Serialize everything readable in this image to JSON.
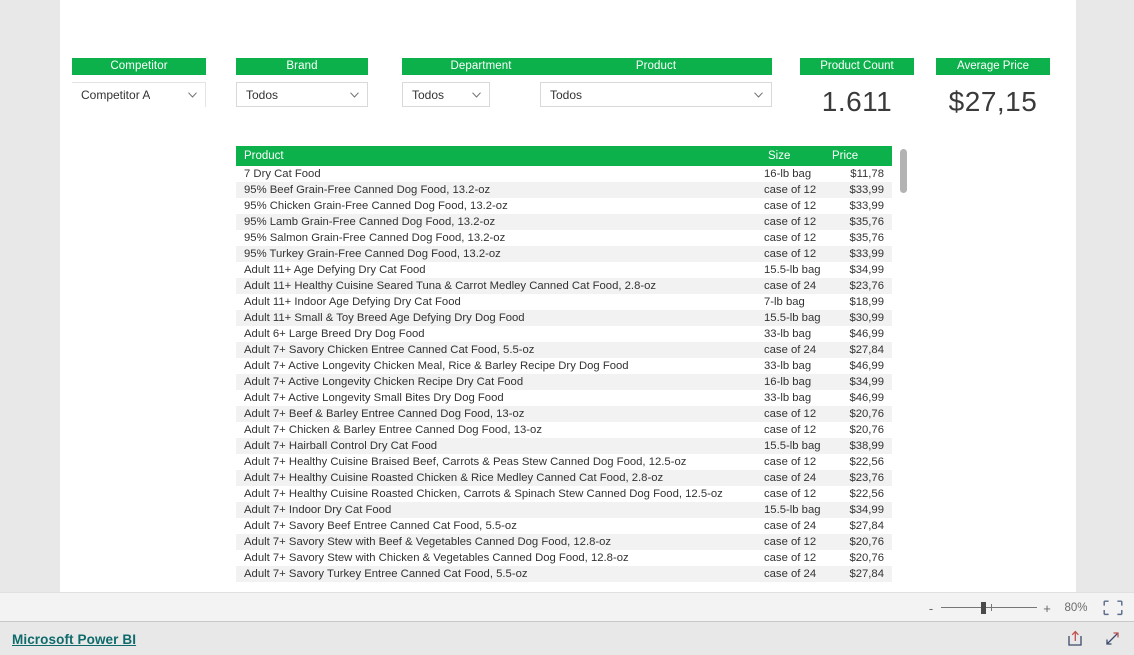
{
  "theme": {
    "accent": "#0CB14B",
    "canvas_bg": "#ffffff",
    "page_bg": "#e8e8e8",
    "row_alt": "#f2f2f2",
    "brand_link": "#0f6b6b"
  },
  "slicers": [
    {
      "title": "Competitor",
      "value": "Competitor A",
      "icon": "chevron-down-icon",
      "name": "competitor"
    },
    {
      "title": "Brand",
      "value": "Todos",
      "icon": "chevron-down-icon",
      "name": "brand"
    },
    {
      "title": "Department",
      "value": "Todos",
      "icon": "chevron-down-icon",
      "name": "department"
    },
    {
      "title": "Product",
      "value": "Todos",
      "icon": "chevron-down-icon",
      "name": "product"
    }
  ],
  "kpis": [
    {
      "title": "Product Count",
      "value": "1.611",
      "name": "product-count"
    },
    {
      "title": "Average Price",
      "value": "$27,15",
      "name": "average-price"
    }
  ],
  "table": {
    "columns": [
      "Product",
      "Size",
      "Price"
    ],
    "rows": [
      [
        "7 Dry Cat Food",
        "16-lb bag",
        "$11,78"
      ],
      [
        "95% Beef Grain-Free Canned Dog Food, 13.2-oz",
        "case of 12",
        "$33,99"
      ],
      [
        "95% Chicken Grain-Free Canned Dog Food, 13.2-oz",
        "case of 12",
        "$33,99"
      ],
      [
        "95% Lamb Grain-Free Canned Dog Food, 13.2-oz",
        "case of 12",
        "$35,76"
      ],
      [
        "95% Salmon Grain-Free Canned Dog Food, 13.2-oz",
        "case of 12",
        "$35,76"
      ],
      [
        "95% Turkey Grain-Free Canned Dog Food, 13.2-oz",
        "case of 12",
        "$33,99"
      ],
      [
        "Adult 11+ Age Defying Dry Cat Food",
        "15.5-lb bag",
        "$34,99"
      ],
      [
        "Adult 11+ Healthy Cuisine Seared Tuna & Carrot Medley Canned Cat Food, 2.8-oz",
        "case of 24",
        "$23,76"
      ],
      [
        "Adult 11+ Indoor Age Defying Dry Cat Food",
        "7-lb bag",
        "$18,99"
      ],
      [
        "Adult 11+ Small & Toy Breed Age Defying Dry Dog Food",
        "15.5-lb bag",
        "$30,99"
      ],
      [
        "Adult 6+ Large Breed Dry Dog Food",
        "33-lb bag",
        "$46,99"
      ],
      [
        "Adult 7+ Savory Chicken Entree Canned Cat Food, 5.5-oz",
        "case of 24",
        "$27,84"
      ],
      [
        "Adult 7+ Active Longevity Chicken Meal, Rice & Barley Recipe Dry Dog Food",
        "33-lb bag",
        "$46,99"
      ],
      [
        "Adult 7+ Active Longevity Chicken Recipe Dry Cat Food",
        "16-lb bag",
        "$34,99"
      ],
      [
        "Adult 7+ Active Longevity Small Bites Dry Dog Food",
        "33-lb bag",
        "$46,99"
      ],
      [
        "Adult 7+ Beef & Barley Entree Canned Dog Food, 13-oz",
        "case of 12",
        "$20,76"
      ],
      [
        "Adult 7+ Chicken & Barley Entree Canned Dog Food, 13-oz",
        "case of 12",
        "$20,76"
      ],
      [
        "Adult 7+ Hairball Control Dry Cat Food",
        "15.5-lb bag",
        "$38,99"
      ],
      [
        "Adult 7+ Healthy Cuisine Braised Beef, Carrots & Peas Stew Canned Dog Food, 12.5-oz",
        "case of 12",
        "$22,56"
      ],
      [
        "Adult 7+ Healthy Cuisine Roasted Chicken & Rice Medley Canned Cat Food, 2.8-oz",
        "case of 24",
        "$23,76"
      ],
      [
        "Adult 7+ Healthy Cuisine Roasted Chicken, Carrots & Spinach Stew Canned Dog Food, 12.5-oz",
        "case of 12",
        "$22,56"
      ],
      [
        "Adult 7+ Indoor Dry Cat Food",
        "15.5-lb bag",
        "$34,99"
      ],
      [
        "Adult 7+ Savory Beef Entree Canned Cat Food, 5.5-oz",
        "case of 24",
        "$27,84"
      ],
      [
        "Adult 7+ Savory Stew with Beef & Vegetables Canned Dog Food, 12.8-oz",
        "case of 12",
        "$20,76"
      ],
      [
        "Adult 7+ Savory Stew with Chicken & Vegetables Canned Dog Food, 12.8-oz",
        "case of 12",
        "$20,76"
      ],
      [
        "Adult 7+ Savory Turkey Entree Canned Cat Food, 5.5-oz",
        "case of 24",
        "$27,84"
      ]
    ]
  },
  "statusbar": {
    "zoom_out_label": "-",
    "zoom_in_label": "+",
    "zoom_level": "80%",
    "fit_icon": "fit-to-page-icon"
  },
  "footer": {
    "brand": "Microsoft Power BI",
    "icons": [
      "share-icon",
      "fullscreen-icon"
    ]
  }
}
